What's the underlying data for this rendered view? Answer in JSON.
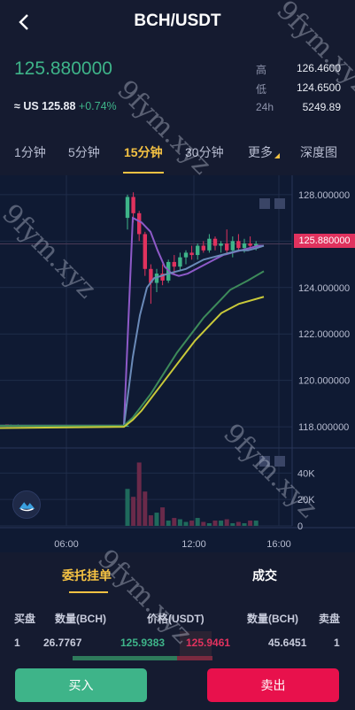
{
  "header": {
    "title": "BCH/USDT",
    "back_icon": "chevron-left-icon"
  },
  "ticker": {
    "last_price": "125.880000",
    "usd_prefix": "≈ US 125.88",
    "change": "+0.74%",
    "high_label": "高",
    "high": "126.4600",
    "low_label": "低",
    "low": "124.6500",
    "vol_label": "24h",
    "vol": "5249.89"
  },
  "tabs": [
    "1分钟",
    "5分钟",
    "15分钟",
    "30分钟",
    "更多",
    "深度图"
  ],
  "active_tab": "15分钟",
  "chart_data": {
    "type": "candlestick",
    "y_ticks": [
      "128.000000",
      "126.000000",
      "124.000000",
      "122.000000",
      "120.000000",
      "118.000000"
    ],
    "ylim": [
      117.7,
      128.3
    ],
    "x_ticks": [
      "06:00",
      "12:00",
      "16:00"
    ],
    "current_price_label": "125.880000",
    "volume_ticks": [
      "40K",
      "20K",
      "0"
    ],
    "candles": [
      [
        118.05,
        118.05,
        118.02,
        118.05
      ],
      [
        118.1,
        118.1,
        118.0,
        118.05
      ],
      [
        118.05,
        118.1,
        118.0,
        118.05
      ],
      [
        118.05,
        118.05,
        118.02,
        118.05
      ],
      [
        118.05,
        118.1,
        118.02,
        118.08
      ],
      [
        118.05,
        118.05,
        118.0,
        118.05
      ],
      [
        118.05,
        118.08,
        118.02,
        118.05
      ],
      [
        118.05,
        118.05,
        118.02,
        118.05
      ],
      [
        118.05,
        118.08,
        118.02,
        118.05
      ],
      [
        118.05,
        118.05,
        118.0,
        118.05
      ],
      [
        118.05,
        118.08,
        118.02,
        118.05
      ],
      [
        118.05,
        118.05,
        118.02,
        118.05
      ],
      [
        118.05,
        118.05,
        118.02,
        118.05
      ],
      [
        118.05,
        118.08,
        118.0,
        118.05
      ],
      [
        118.05,
        118.05,
        118.02,
        118.05
      ],
      [
        118.05,
        118.05,
        118.02,
        118.05
      ],
      [
        118.05,
        118.08,
        118.02,
        118.05
      ],
      [
        118.05,
        118.05,
        118.0,
        118.05
      ],
      [
        118.05,
        118.05,
        118.02,
        118.05
      ],
      [
        118.05,
        118.08,
        118.02,
        118.05
      ],
      [
        118.05,
        118.05,
        118.02,
        118.05
      ],
      [
        118.05,
        118.05,
        118.0,
        118.05
      ],
      [
        118.05,
        118.08,
        118.02,
        118.05
      ],
      [
        118.05,
        118.05,
        118.02,
        118.05
      ],
      [
        118.05,
        118.05,
        118.02,
        118.05
      ],
      [
        118.05,
        118.08,
        118.0,
        118.05
      ],
      [
        118.05,
        118.05,
        118.02,
        118.05
      ],
      [
        118.05,
        118.08,
        118.02,
        118.05
      ],
      [
        118.05,
        118.05,
        118.02,
        118.05
      ],
      [
        118.05,
        118.05,
        118.0,
        118.05
      ],
      [
        118.05,
        118.05,
        118.02,
        118.05
      ],
      [
        118.05,
        118.08,
        118.02,
        118.05
      ],
      [
        118.05,
        118.05,
        118.02,
        118.05
      ],
      [
        118.05,
        118.05,
        118.0,
        118.05
      ],
      [
        118.05,
        118.08,
        118.02,
        118.05
      ],
      [
        127.0,
        128.0,
        126.5,
        127.9
      ],
      [
        127.9,
        128.1,
        126.8,
        127.2
      ],
      [
        127.2,
        127.3,
        126.0,
        126.3
      ],
      [
        126.3,
        126.4,
        124.5,
        124.8
      ],
      [
        124.8,
        125.0,
        123.3,
        124.2
      ],
      [
        124.2,
        124.8,
        123.8,
        124.6
      ],
      [
        124.6,
        125.0,
        124.1,
        124.3
      ],
      [
        124.3,
        125.2,
        124.2,
        125.1
      ],
      [
        125.1,
        125.4,
        124.6,
        124.9
      ],
      [
        124.9,
        125.5,
        124.7,
        125.3
      ],
      [
        125.3,
        125.6,
        125.0,
        125.5
      ],
      [
        125.5,
        125.8,
        125.2,
        125.4
      ],
      [
        125.4,
        125.9,
        125.2,
        125.8
      ],
      [
        125.8,
        126.0,
        125.5,
        125.6
      ],
      [
        125.6,
        126.3,
        125.5,
        126.1
      ],
      [
        126.1,
        126.2,
        125.6,
        125.8
      ],
      [
        125.8,
        126.0,
        125.5,
        125.9
      ],
      [
        125.9,
        126.5,
        125.4,
        125.6
      ],
      [
        125.6,
        126.2,
        125.3,
        126.0
      ],
      [
        126.0,
        126.3,
        125.6,
        125.7
      ],
      [
        125.7,
        126.1,
        125.5,
        125.9
      ],
      [
        125.9,
        126.2,
        125.7,
        125.8
      ],
      [
        125.8,
        126.0,
        125.6,
        125.88
      ]
    ],
    "ma_series": [
      {
        "color": "#8e5ac8",
        "values": [
          118.05,
          118.05,
          127.0,
          126.8,
          126.4,
          125.6,
          124.9,
          124.6,
          124.5,
          124.6,
          124.8,
          125.0,
          125.2,
          125.4,
          125.5,
          125.6,
          125.7,
          125.8,
          125.8
        ]
      },
      {
        "color": "#6a8ab8",
        "values": [
          118.05,
          118.05,
          121.0,
          122.8,
          124.0,
          124.4,
          124.5,
          124.6,
          124.7,
          124.8,
          125.0,
          125.2,
          125.3,
          125.4,
          125.5,
          125.6,
          125.6,
          125.7,
          125.8
        ]
      },
      {
        "color": "#3d8a5a",
        "values": [
          118.05,
          118.05,
          118.4,
          118.9,
          119.4,
          120.0,
          120.6,
          121.2,
          121.7,
          122.2,
          122.7,
          123.1,
          123.5,
          123.9,
          124.3,
          124.7
        ]
      },
      {
        "color": "#c9c93a",
        "values": [
          117.95,
          118.0,
          118.3,
          118.7,
          119.2,
          119.7,
          120.2,
          120.7,
          121.2,
          121.7,
          122.1,
          122.5,
          122.9,
          123.3,
          123.6
        ]
      }
    ],
    "volumes": [
      0,
      0,
      0,
      0,
      0,
      0,
      0,
      0,
      0,
      0,
      0,
      0,
      0,
      0,
      0,
      0,
      0,
      0,
      0,
      0,
      0,
      0,
      0,
      0,
      0,
      0,
      0,
      0,
      0,
      0,
      0,
      0,
      0,
      0,
      0,
      28,
      22,
      48,
      26,
      8,
      10,
      14,
      4,
      6,
      5,
      3,
      4,
      6,
      3,
      2,
      4,
      4,
      5,
      2,
      3,
      2,
      4,
      4
    ]
  },
  "order_tabs": {
    "active": "委托挂单",
    "inactive": "成交"
  },
  "orderbook": {
    "headers": {
      "buy": "买盘",
      "qty_left": "数量(BCH)",
      "price": "价格(USDT)",
      "qty_right": "数量(BCH)",
      "sell": "卖盘"
    },
    "rows": [
      {
        "idx_left": "1",
        "qty_left": "26.7767",
        "bid": "125.9383",
        "ask": "125.9461",
        "qty_right": "45.6451",
        "idx_right": "1"
      }
    ]
  },
  "actions": {
    "buy": "买入",
    "sell": "卖出"
  },
  "watermark": "9fym.xyz"
}
